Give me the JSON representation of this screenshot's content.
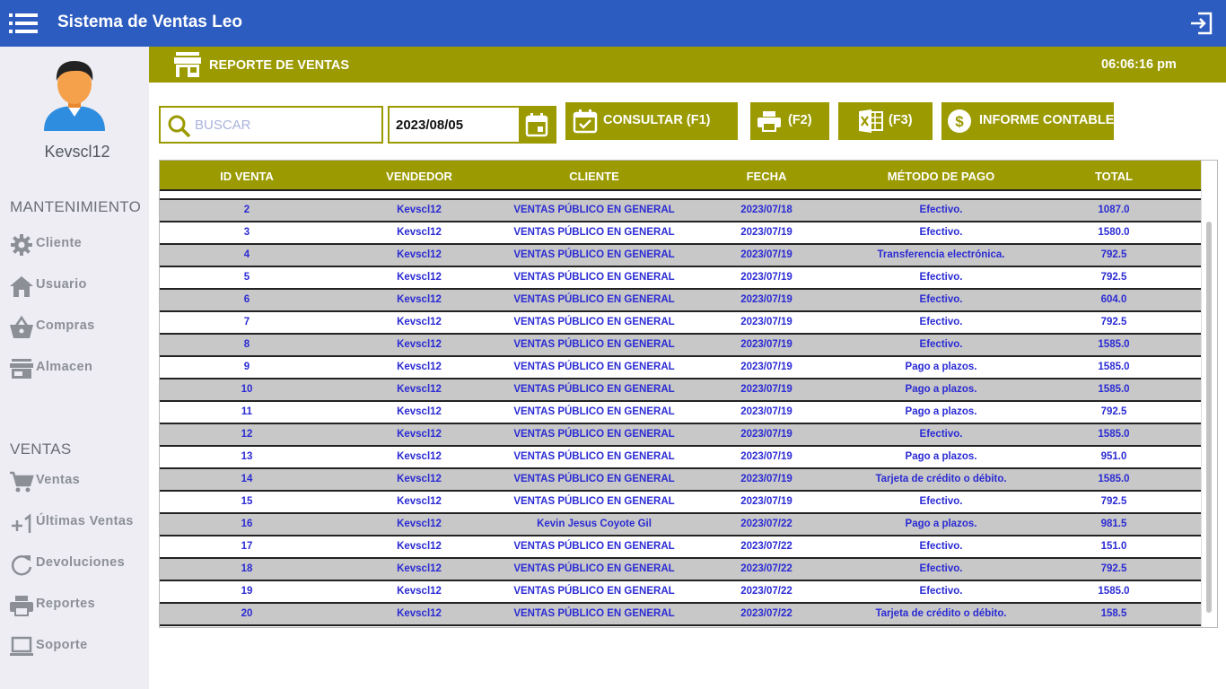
{
  "app": {
    "title": "Sistema de Ventas Leo",
    "menu_icon": "hamburger-menu-icon",
    "exit_icon": "logout-icon"
  },
  "colors": {
    "topbar": "#2d5cc0",
    "accent": "#9b9a00",
    "sidebar_bg": "#ededf3",
    "row_alt": "#c8c8c8",
    "cell_text": "#2b2bd4"
  },
  "sidebar": {
    "username": "Kevscl12",
    "sections": [
      {
        "title": "MANTENIMIENTO",
        "items": [
          {
            "label": "Cliente",
            "icon": "gear-icon"
          },
          {
            "label": "Usuario",
            "icon": "home-icon"
          },
          {
            "label": "Compras",
            "icon": "basket-icon"
          },
          {
            "label": "Almacen",
            "icon": "store-icon"
          }
        ]
      },
      {
        "title": "VENTAS",
        "items": [
          {
            "label": "Ventas",
            "icon": "cart-icon"
          },
          {
            "label": "Últimas Ventas",
            "icon": "plus-one-icon"
          },
          {
            "label": "Devoluciones",
            "icon": "refresh-icon"
          },
          {
            "label": "Reportes",
            "icon": "printer-icon"
          },
          {
            "label": "Soporte",
            "icon": "laptop-icon"
          }
        ]
      }
    ]
  },
  "header": {
    "title": "REPORTE DE VENTAS",
    "clock": "06:06:16 pm"
  },
  "toolbar": {
    "search_placeholder": "BUSCAR",
    "date_value": "2023/08/05",
    "consult_label": "CONSULTAR (F1)",
    "print_label": "(F2)",
    "excel_label": "(F3)",
    "report_label": "INFORME CONTABLE"
  },
  "table": {
    "columns": [
      "ID VENTA",
      "VENDEDOR",
      "CLIENTE",
      "FECHA",
      "MÉTODO DE PAGO",
      "TOTAL"
    ],
    "rows": [
      [
        "2",
        "Kevscl12",
        "VENTAS PÚBLICO EN GENERAL",
        "2023/07/18",
        "Efectivo.",
        "1087.0"
      ],
      [
        "3",
        "Kevscl12",
        "VENTAS PÚBLICO EN GENERAL",
        "2023/07/19",
        "Efectivo.",
        "1580.0"
      ],
      [
        "4",
        "Kevscl12",
        "VENTAS PÚBLICO EN GENERAL",
        "2023/07/19",
        "Transferencia electrónica.",
        "792.5"
      ],
      [
        "5",
        "Kevscl12",
        "VENTAS PÚBLICO EN GENERAL",
        "2023/07/19",
        "Efectivo.",
        "792.5"
      ],
      [
        "6",
        "Kevscl12",
        "VENTAS PÚBLICO EN GENERAL",
        "2023/07/19",
        "Efectivo.",
        "604.0"
      ],
      [
        "7",
        "Kevscl12",
        "VENTAS PÚBLICO EN GENERAL",
        "2023/07/19",
        "Efectivo.",
        "792.5"
      ],
      [
        "8",
        "Kevscl12",
        "VENTAS PÚBLICO EN GENERAL",
        "2023/07/19",
        "Efectivo.",
        "1585.0"
      ],
      [
        "9",
        "Kevscl12",
        "VENTAS PÚBLICO EN GENERAL",
        "2023/07/19",
        "Pago a plazos.",
        "1585.0"
      ],
      [
        "10",
        "Kevscl12",
        "VENTAS PÚBLICO EN GENERAL",
        "2023/07/19",
        "Pago a plazos.",
        "1585.0"
      ],
      [
        "11",
        "Kevscl12",
        "VENTAS PÚBLICO EN GENERAL",
        "2023/07/19",
        "Pago a plazos.",
        "792.5"
      ],
      [
        "12",
        "Kevscl12",
        "VENTAS PÚBLICO EN GENERAL",
        "2023/07/19",
        "Efectivo.",
        "1585.0"
      ],
      [
        "13",
        "Kevscl12",
        "VENTAS PÚBLICO EN GENERAL",
        "2023/07/19",
        "Pago a plazos.",
        "951.0"
      ],
      [
        "14",
        "Kevscl12",
        "VENTAS PÚBLICO EN GENERAL",
        "2023/07/19",
        "Tarjeta de crédito o débito.",
        "1585.0"
      ],
      [
        "15",
        "Kevscl12",
        "VENTAS PÚBLICO EN GENERAL",
        "2023/07/19",
        "Efectivo.",
        "792.5"
      ],
      [
        "16",
        "Kevscl12",
        "Kevin Jesus Coyote Gil",
        "2023/07/22",
        "Pago a plazos.",
        "981.5"
      ],
      [
        "17",
        "Kevscl12",
        "VENTAS PÚBLICO EN GENERAL",
        "2023/07/22",
        "Efectivo.",
        "151.0"
      ],
      [
        "18",
        "Kevscl12",
        "VENTAS PÚBLICO EN GENERAL",
        "2023/07/22",
        "Efectivo.",
        "792.5"
      ],
      [
        "19",
        "Kevscl12",
        "VENTAS PÚBLICO EN GENERAL",
        "2023/07/22",
        "Efectivo.",
        "1585.0"
      ],
      [
        "20",
        "Kevscl12",
        "VENTAS PÚBLICO EN GENERAL",
        "2023/07/22",
        "Tarjeta de crédito o débito.",
        "158.5"
      ]
    ]
  }
}
